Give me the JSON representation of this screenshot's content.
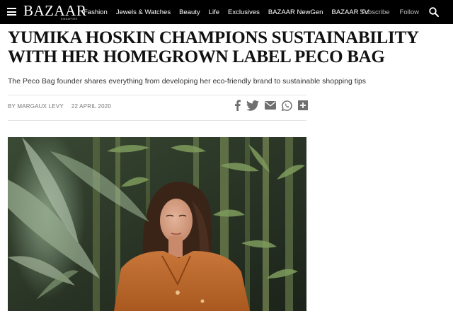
{
  "header": {
    "logo": "BAZAAR",
    "logo_sub": "SINGAPORE",
    "nav": [
      "Fashion",
      "Jewels & Watches",
      "Beauty",
      "Life",
      "Exclusives",
      "BAZAAR NewGen",
      "BAZAAR TV"
    ],
    "subscribe": "Subscribe",
    "follow": "Follow"
  },
  "article": {
    "headline": "Yumika Hoskin Champions Sustainability With Her Homegrown Label Peco Bag",
    "dek": "The Peco Bag founder shares everything from developing her eco-friendly brand to sustainable shopping tips",
    "author": "By Margaux Levy",
    "date": "22 April 2020",
    "share_icons": [
      "facebook-icon",
      "twitter-icon",
      "email-icon",
      "whatsapp-icon",
      "more-share-icon"
    ]
  },
  "colors": {
    "topbar": "#000000",
    "share_icon": "#6f6f6f",
    "foliage": "#5c7a4a",
    "jacket": "#b8652a"
  }
}
